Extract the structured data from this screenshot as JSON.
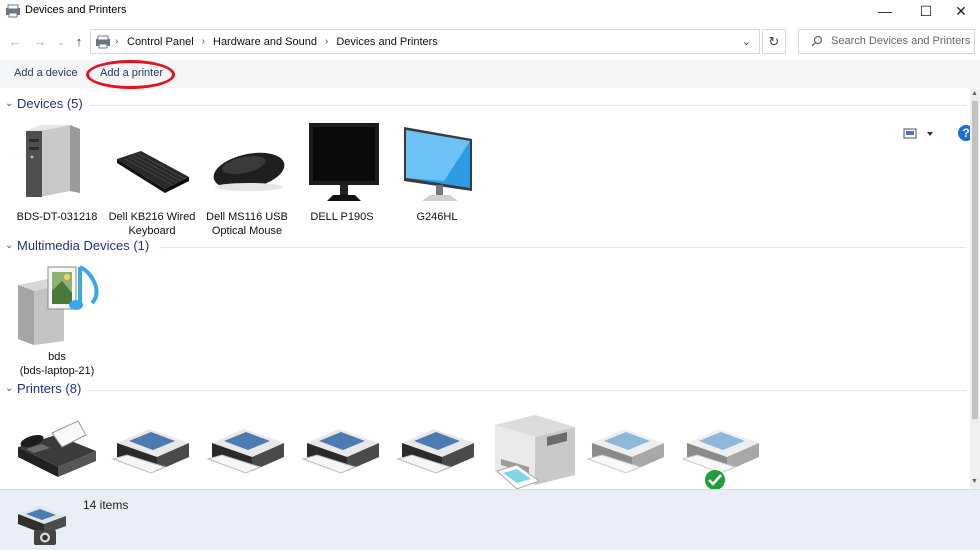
{
  "window": {
    "title": "Devices and Printers",
    "minimize_glyph": "—",
    "maximize_glyph": "☐",
    "close_glyph": "✕"
  },
  "address": {
    "breadcrumbs": [
      "Control Panel",
      "Hardware and Sound",
      "Devices and Printers"
    ],
    "search_placeholder": "Search Devices and Printers"
  },
  "toolbar": {
    "add_device": "Add a device",
    "add_printer": "Add a printer",
    "help": "?"
  },
  "groups": {
    "devices": {
      "title": "Devices (5)",
      "items": [
        "BDS-DT-031218",
        "Dell KB216 Wired Keyboard",
        "Dell MS116 USB Optical Mouse",
        "DELL P190S",
        "G246HL"
      ]
    },
    "multimedia": {
      "title": "Multimedia Devices (1)",
      "items": [
        "bds\n(bds-laptop-21)"
      ]
    },
    "printers": {
      "title": "Printers (8)"
    }
  },
  "status": {
    "count": "14 items"
  },
  "colors": {
    "accent": "#1e3287",
    "highlight_oval": "#e0141e",
    "status_bg": "#e9eef6"
  }
}
